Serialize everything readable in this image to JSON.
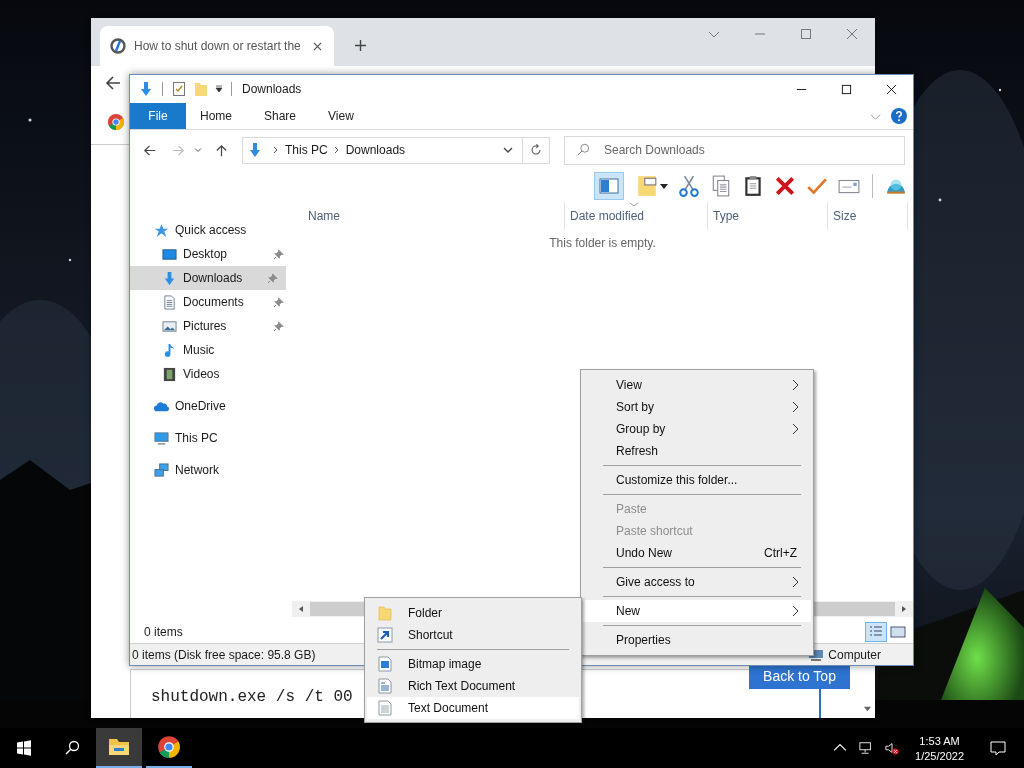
{
  "browser": {
    "tab_title": "How to shut down or restart the",
    "page": {
      "code": "shutdown.exe /s /t 00",
      "button": "Back to Top"
    }
  },
  "explorer": {
    "title": "Downloads",
    "ribbon_tabs": [
      {
        "label": "File",
        "kind": "file"
      },
      {
        "label": "Home",
        "kind": "tab"
      },
      {
        "label": "Share",
        "kind": "tab"
      },
      {
        "label": "View",
        "kind": "tab"
      }
    ],
    "breadcrumb": [
      "This PC",
      "Downloads"
    ],
    "search": {
      "placeholder": "Search Downloads"
    },
    "toolbar": {
      "preview_pane": true
    },
    "columns": [
      {
        "label": "Name",
        "sorted": false
      },
      {
        "label": "Date modified",
        "sorted": true
      },
      {
        "label": "Type",
        "sorted": false
      },
      {
        "label": "Size",
        "sorted": false
      }
    ],
    "empty_message": "This folder is empty.",
    "sidebar": {
      "items": [
        {
          "label": "Quick access",
          "selected": false,
          "children": [
            {
              "label": "Desktop",
              "selected": false,
              "pinned": true
            },
            {
              "label": "Downloads",
              "selected": true,
              "pinned": true
            },
            {
              "label": "Documents",
              "selected": false,
              "pinned": true
            },
            {
              "label": "Pictures",
              "selected": false,
              "pinned": true
            },
            {
              "label": "Music",
              "selected": false,
              "pinned": false
            },
            {
              "label": "Videos",
              "selected": false,
              "pinned": false
            }
          ]
        },
        {
          "label": "OneDrive",
          "selected": false
        },
        {
          "label": "This PC",
          "selected": false
        },
        {
          "label": "Network",
          "selected": false
        }
      ]
    },
    "status": "0 items",
    "view_buttons": [
      {
        "selected": true
      },
      {
        "selected": false
      }
    ],
    "details": "0 items (Disk free space: 95.8 GB)",
    "location": "Computer"
  },
  "context_menu": {
    "items": [
      {
        "kind": "item",
        "label": "View",
        "submenu": true,
        "disabled": false,
        "selected": false
      },
      {
        "kind": "item",
        "label": "Sort by",
        "submenu": true,
        "disabled": false,
        "selected": false
      },
      {
        "kind": "item",
        "label": "Group by",
        "submenu": true,
        "disabled": false,
        "selected": false
      },
      {
        "kind": "item",
        "label": "Refresh",
        "submenu": false,
        "disabled": false,
        "selected": false
      },
      {
        "kind": "separator"
      },
      {
        "kind": "item",
        "label": "Customize this folder...",
        "submenu": false,
        "disabled": false,
        "selected": false
      },
      {
        "kind": "separator"
      },
      {
        "kind": "item",
        "label": "Paste",
        "submenu": false,
        "disabled": true,
        "selected": false
      },
      {
        "kind": "item",
        "label": "Paste shortcut",
        "submenu": false,
        "disabled": true,
        "selected": false
      },
      {
        "kind": "item",
        "label": "Undo New",
        "shortcut": "Ctrl+Z",
        "submenu": false,
        "disabled": false,
        "selected": false
      },
      {
        "kind": "separator"
      },
      {
        "kind": "item",
        "label": "Give access to",
        "submenu": true,
        "disabled": false,
        "selected": false
      },
      {
        "kind": "separator"
      },
      {
        "kind": "item",
        "label": "New",
        "submenu": true,
        "disabled": false,
        "selected": true
      },
      {
        "kind": "separator"
      },
      {
        "kind": "item",
        "label": "Properties",
        "submenu": false,
        "disabled": false,
        "selected": false
      }
    ]
  },
  "new_submenu": {
    "items": [
      {
        "kind": "item",
        "label": "Folder",
        "selected": false
      },
      {
        "kind": "item",
        "label": "Shortcut",
        "selected": false
      },
      {
        "kind": "separator"
      },
      {
        "kind": "item",
        "label": "Bitmap image",
        "selected": false
      },
      {
        "kind": "item",
        "label": "Rich Text Document",
        "selected": false
      },
      {
        "kind": "item",
        "label": "Text Document",
        "selected": true
      }
    ]
  },
  "taskbar": {
    "apps": [
      {
        "selected": true
      },
      {
        "selected": false
      }
    ],
    "time": "1:53 AM",
    "date": "1/25/2022"
  }
}
